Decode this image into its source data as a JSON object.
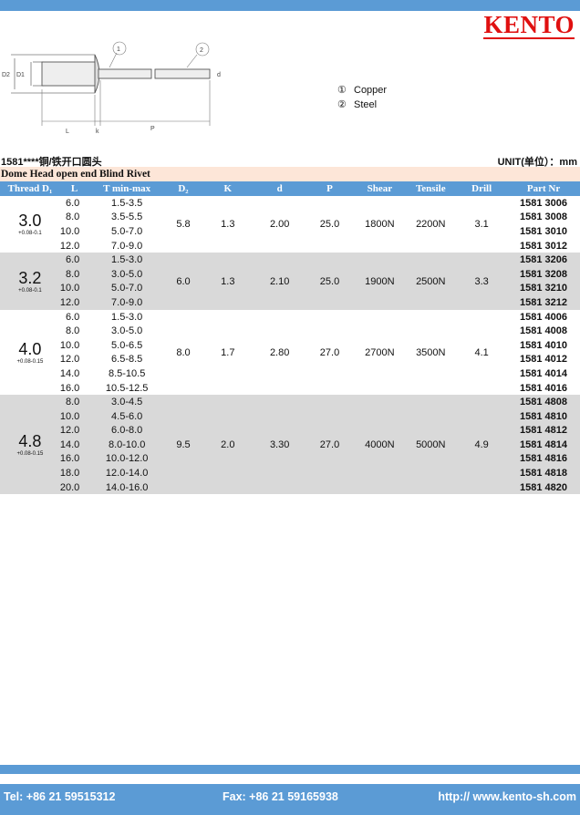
{
  "brand": {
    "logo": "KENTO"
  },
  "legend": [
    {
      "symbol": "①",
      "label": "Copper"
    },
    {
      "symbol": "②",
      "label": "Steel"
    }
  ],
  "drawing": {
    "callout1": "1",
    "callout2": "2",
    "d2": "D2",
    "d1": "D1",
    "l": "L",
    "k": "k",
    "p": "P",
    "d": "d"
  },
  "header": {
    "product_code": "1581****铜/铁开口圆头",
    "unit": "UNIT(单位）：mm",
    "title": "Dome Head open end Blind Rivet"
  },
  "table": {
    "columns": [
      "Thread D₁",
      "L",
      "T min-max",
      "D₂",
      "K",
      "d",
      "P",
      "Shear",
      "Tensile",
      "Drill",
      "Part Nr"
    ],
    "groups": [
      {
        "thread": "3.0",
        "tol": "+0.08-0.1",
        "D2": "5.8",
        "K": "1.3",
        "d": "2.00",
        "P": "25.0",
        "shear": "1800N",
        "tensile": "2200N",
        "drill": "3.1",
        "rows": [
          [
            "6.0",
            "1.5-3.5",
            "1581 3006"
          ],
          [
            "8.0",
            "3.5-5.5",
            "1581 3008"
          ],
          [
            "10.0",
            "5.0-7.0",
            "1581 3010"
          ],
          [
            "12.0",
            "7.0-9.0",
            "1581 3012"
          ]
        ]
      },
      {
        "thread": "3.2",
        "tol": "+0.08-0.1",
        "D2": "6.0",
        "K": "1.3",
        "d": "2.10",
        "P": "25.0",
        "shear": "1900N",
        "tensile": "2500N",
        "drill": "3.3",
        "rows": [
          [
            "6.0",
            "1.5-3.0",
            "1581 3206"
          ],
          [
            "8.0",
            "3.0-5.0",
            "1581 3208"
          ],
          [
            "10.0",
            "5.0-7.0",
            "1581 3210"
          ],
          [
            "12.0",
            "7.0-9.0",
            "1581 3212"
          ]
        ]
      },
      {
        "thread": "4.0",
        "tol": "+0.08-0.15",
        "D2": "8.0",
        "K": "1.7",
        "d": "2.80",
        "P": "27.0",
        "shear": "2700N",
        "tensile": "3500N",
        "drill": "4.1",
        "rows": [
          [
            "6.0",
            "1.5-3.0",
            "1581 4006"
          ],
          [
            "8.0",
            "3.0-5.0",
            "1581 4008"
          ],
          [
            "10.0",
            "5.0-6.5",
            "1581 4010"
          ],
          [
            "12.0",
            "6.5-8.5",
            "1581 4012"
          ],
          [
            "14.0",
            "8.5-10.5",
            "1581 4014"
          ],
          [
            "16.0",
            "10.5-12.5",
            "1581 4016"
          ]
        ]
      },
      {
        "thread": "4.8",
        "tol": "+0.08-0.15",
        "D2": "9.5",
        "K": "2.0",
        "d": "3.30",
        "P": "27.0",
        "shear": "4000N",
        "tensile": "5000N",
        "drill": "4.9",
        "rows": [
          [
            "8.0",
            "3.0-4.5",
            "1581 4808"
          ],
          [
            "10.0",
            "4.5-6.0",
            "1581 4810"
          ],
          [
            "12.0",
            "6.0-8.0",
            "1581 4812"
          ],
          [
            "14.0",
            "8.0-10.0",
            "1581 4814"
          ],
          [
            "16.0",
            "10.0-12.0",
            "1581 4816"
          ],
          [
            "18.0",
            "12.0-14.0",
            "1581 4818"
          ],
          [
            "20.0",
            "14.0-16.0",
            "1581 4820"
          ]
        ]
      }
    ]
  },
  "footer": {
    "tel": "Tel: +86 21 59515312",
    "fax": "Fax: +86 21 59165938",
    "web": "http:// www.kento-sh.com"
  }
}
